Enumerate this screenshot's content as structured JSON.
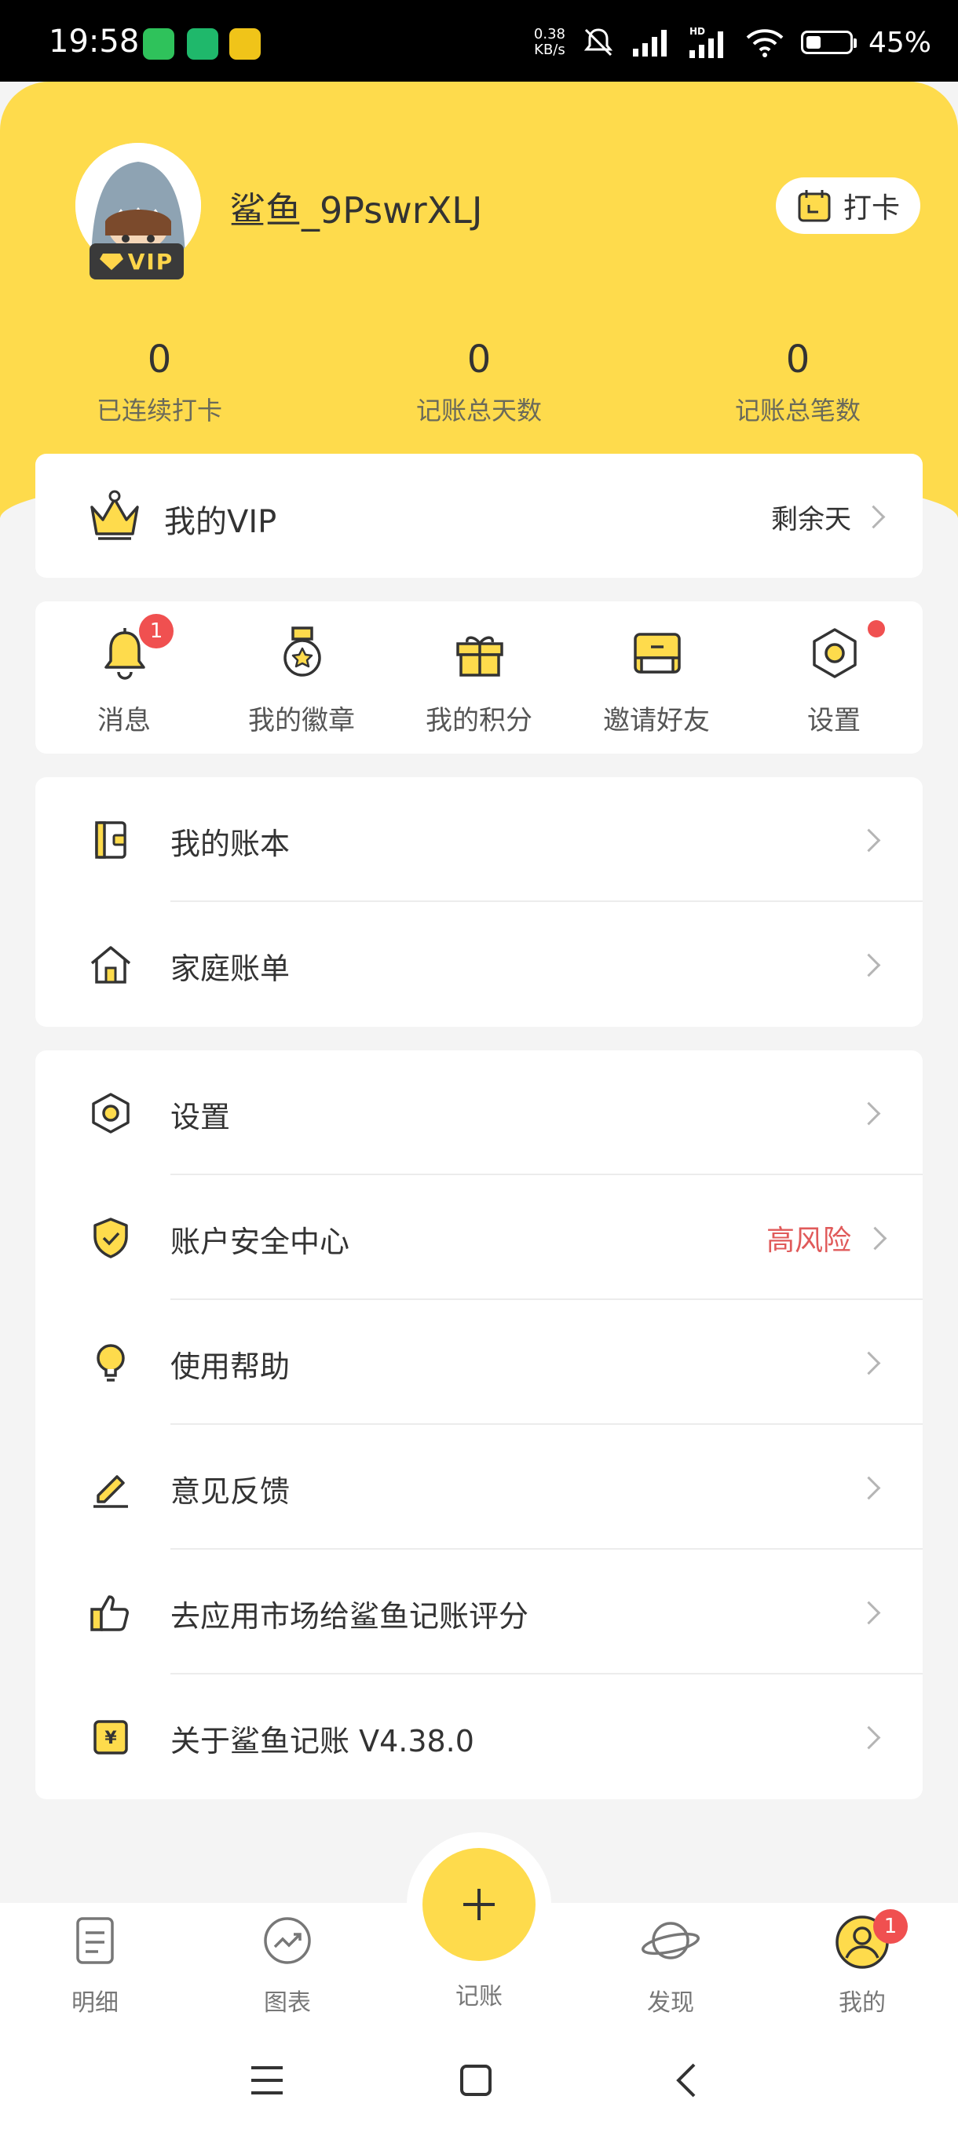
{
  "status_bar": {
    "time": "19:58",
    "net_speed_value": "0.38",
    "net_speed_unit": "KB/s",
    "battery": "45%",
    "app_icons": [
      "messages-icon",
      "browser-icon",
      "game-icon"
    ]
  },
  "profile": {
    "username": "鲨鱼_9PswrXLJ",
    "vip_tag": "VIP",
    "checkin_label": "打卡"
  },
  "stats": [
    {
      "value": "0",
      "label": "已连续打卡"
    },
    {
      "value": "0",
      "label": "记账总天数"
    },
    {
      "value": "0",
      "label": "记账总笔数"
    }
  ],
  "vip_card": {
    "title": "我的VIP",
    "remaining": "剩余天"
  },
  "quick_actions": [
    {
      "label": "消息",
      "badge": "1",
      "icon": "bell-icon"
    },
    {
      "label": "我的徽章",
      "icon": "medal-icon"
    },
    {
      "label": "我的积分",
      "icon": "gift-icon"
    },
    {
      "label": "邀请好友",
      "icon": "envelope-icon"
    },
    {
      "label": "设置",
      "icon": "settings-icon",
      "dot": true
    }
  ],
  "menu_group1": [
    {
      "label": "我的账本",
      "icon": "wallet-icon"
    },
    {
      "label": "家庭账单",
      "icon": "house-icon"
    }
  ],
  "menu_group2": [
    {
      "label": "设置",
      "icon": "settings-icon"
    },
    {
      "label": "账户安全中心",
      "icon": "shield-icon",
      "status": "高风险"
    },
    {
      "label": "使用帮助",
      "icon": "lightbulb-icon"
    },
    {
      "label": "意见反馈",
      "icon": "edit-icon"
    },
    {
      "label": "去应用市场给鲨鱼记账评分",
      "icon": "thumbs-up-icon"
    },
    {
      "label": "关于鲨鱼记账 V4.38.0",
      "icon": "yuan-icon"
    }
  ],
  "bottom_nav": [
    {
      "label": "明细",
      "icon": "list-icon"
    },
    {
      "label": "图表",
      "icon": "chart-icon"
    },
    {
      "label": "记账",
      "icon": "plus-icon"
    },
    {
      "label": "发现",
      "icon": "planet-icon"
    },
    {
      "label": "我的",
      "icon": "user-icon",
      "badge": "1"
    }
  ],
  "colors": {
    "brand_yellow": "#fedb4c",
    "alert_red": "#f05050",
    "risk_text": "#e05a5a"
  }
}
